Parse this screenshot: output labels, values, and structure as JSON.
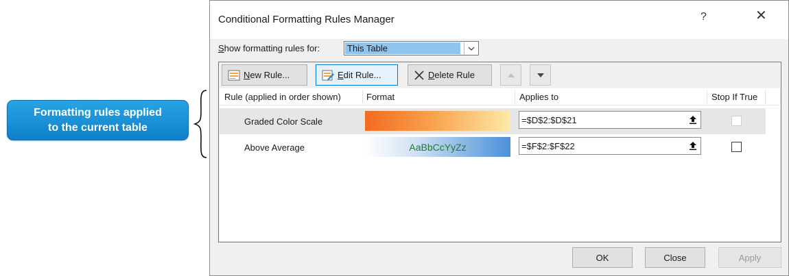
{
  "callout": {
    "line1": "Formatting rules applied",
    "line2": "to the current table"
  },
  "dialog": {
    "title": "Conditional Formatting Rules Manager",
    "help": "?",
    "close": "✕",
    "show_label": "Show formatting rules for:",
    "show_value": "This Table",
    "toolbar": {
      "new_rule": "New Rule...",
      "edit_rule": "Edit Rule...",
      "delete_rule": "Delete Rule"
    },
    "columns": {
      "rule": "Rule (applied in order shown)",
      "format": "Format",
      "applies": "Applies to",
      "stop": "Stop If True"
    },
    "rules": [
      {
        "name": "Graded Color Scale",
        "format_colors": [
          "#f36b23",
          "#fde9a8"
        ],
        "applies_to": "=$D$2:$D$21",
        "stop_if_true": false,
        "selected": true
      },
      {
        "name": "Above Average",
        "preview_text": "AaBbCcYyZz",
        "format_colors": [
          "#ffffff",
          "#4a90d9"
        ],
        "preview_color": "#1e7b32",
        "applies_to": "=$F$2:$F$22",
        "stop_if_true": false,
        "selected": false
      }
    ],
    "buttons": {
      "ok": "OK",
      "close": "Close",
      "apply": "Apply"
    }
  }
}
